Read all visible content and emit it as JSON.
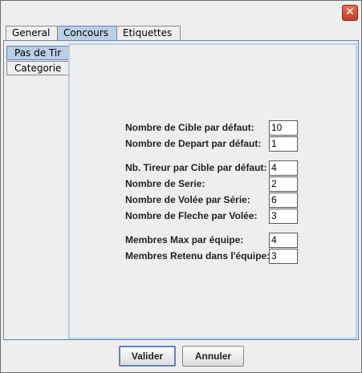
{
  "titlebar": {
    "close_icon": "close-icon"
  },
  "tabs": [
    {
      "label": "General",
      "selected": false
    },
    {
      "label": "Concours",
      "selected": true
    },
    {
      "label": "Etiquettes",
      "selected": false
    }
  ],
  "side_tabs": [
    {
      "label": "Pas de Tir",
      "selected": true
    },
    {
      "label": "Categorie",
      "selected": false
    }
  ],
  "fields": [
    {
      "label": "Nombre de Cible par défaut:",
      "value": "10"
    },
    {
      "label": "Nombre de Depart par défaut:",
      "value": "1"
    },
    {
      "label": "Nb. Tireur par Cible par défaut:",
      "value": "4"
    },
    {
      "label": "Nombre de Serie:",
      "value": "2"
    },
    {
      "label": "Nombre de Volée par Série:",
      "value": "6"
    },
    {
      "label": "Nombre de Fleche par Volée:",
      "value": "3"
    },
    {
      "label": "Membres Max par équipe:",
      "value": "4"
    },
    {
      "label": "Membres Retenu dans l'équipe:",
      "value": "3"
    }
  ],
  "buttons": {
    "validate": "Valider",
    "cancel": "Annuler"
  },
  "colors": {
    "selection": "#b8cfe5",
    "border_accent": "#6382bf",
    "close": "#c43c22"
  }
}
